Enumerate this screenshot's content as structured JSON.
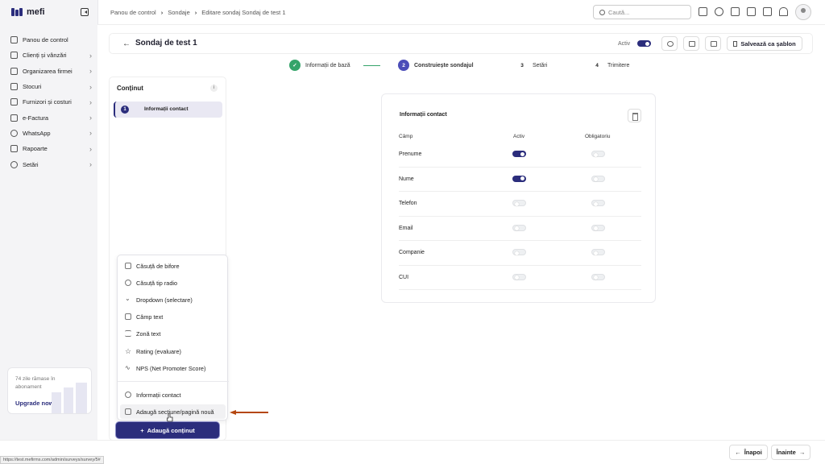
{
  "app": {
    "logo": "mefi"
  },
  "sidebar": {
    "items": [
      {
        "label": "Panou de control",
        "icon": "home-icon",
        "chevron": false
      },
      {
        "label": "Clienți și vânzări",
        "icon": "users-icon",
        "chevron": true
      },
      {
        "label": "Organizarea firmei",
        "icon": "org-icon",
        "chevron": true
      },
      {
        "label": "Stocuri",
        "icon": "box-icon",
        "chevron": true
      },
      {
        "label": "Furnizori și costuri",
        "icon": "wallet-icon",
        "chevron": true
      },
      {
        "label": "e-Factura",
        "icon": "invoice-icon",
        "chevron": true
      },
      {
        "label": "WhatsApp",
        "icon": "whatsapp-icon",
        "chevron": true
      },
      {
        "label": "Rapoarte",
        "icon": "clipboard-icon",
        "chevron": true
      },
      {
        "label": "Setări",
        "icon": "gear-icon",
        "chevron": true
      }
    ],
    "upsell": {
      "text": "74 zile rămase în abonament",
      "link": "Upgrade now"
    }
  },
  "topbar": {
    "breadcrumb": [
      "Panou de control",
      "Sondaje",
      "Editare sondaj Sondaj de test 1"
    ],
    "search_placeholder": "Caută..."
  },
  "header": {
    "title": "Sondaj de test 1",
    "active_label": "Activ",
    "active": true,
    "save_template": "Salvează ca șablon"
  },
  "steps": [
    {
      "num": "✓",
      "label": "Informații de bază",
      "state": "done"
    },
    {
      "num": "2",
      "label": "Construiește sondajul",
      "state": "active"
    },
    {
      "num": "3",
      "label": "Setări",
      "state": "todo"
    },
    {
      "num": "4",
      "label": "Trimitere",
      "state": "todo"
    }
  ],
  "content_panel": {
    "title": "Conținut",
    "info": "i",
    "items": [
      {
        "num": "1",
        "label": "Informații contact"
      }
    ]
  },
  "add_menu": {
    "items": [
      {
        "label": "Căsuță de bifore",
        "icon": "checkbox-icon"
      },
      {
        "label": "Căsuță tip radio",
        "icon": "radio-icon"
      },
      {
        "label": "Dropdown (selectare)",
        "icon": "chevron-down-icon"
      },
      {
        "label": "Câmp text",
        "icon": "edit-icon"
      },
      {
        "label": "Zonă text",
        "icon": "textarea-icon"
      },
      {
        "label": "Rating (evaluare)",
        "icon": "star-icon"
      },
      {
        "label": "NPS (Net Promoter Score)",
        "icon": "pulse-icon"
      },
      {
        "label": "Informații contact",
        "icon": "user-icon"
      },
      {
        "label": "Adaugă secțiune/pagină nouă",
        "icon": "layout-icon"
      }
    ],
    "button": "Adaugă conținut"
  },
  "contact_card": {
    "title": "Informații contact",
    "columns": [
      "Câmp",
      "Activ",
      "Obligatoriu"
    ],
    "rows": [
      {
        "field": "Prenume",
        "active": true,
        "required": false
      },
      {
        "field": "Nume",
        "active": true,
        "required": false
      },
      {
        "field": "Telefon",
        "active": false,
        "required": false
      },
      {
        "field": "Email",
        "active": false,
        "required": false
      },
      {
        "field": "Companie",
        "active": false,
        "required": false
      },
      {
        "field": "CUI",
        "active": false,
        "required": false
      }
    ]
  },
  "footer": {
    "back": "Înapoi",
    "next": "Înainte",
    "status_url": "https://test.mefirms.com/admin/surveys/survey/5#"
  },
  "colors": {
    "accent": "#2b2d7c",
    "success": "#35a46a",
    "annotation_arrow": "#b5470f"
  }
}
